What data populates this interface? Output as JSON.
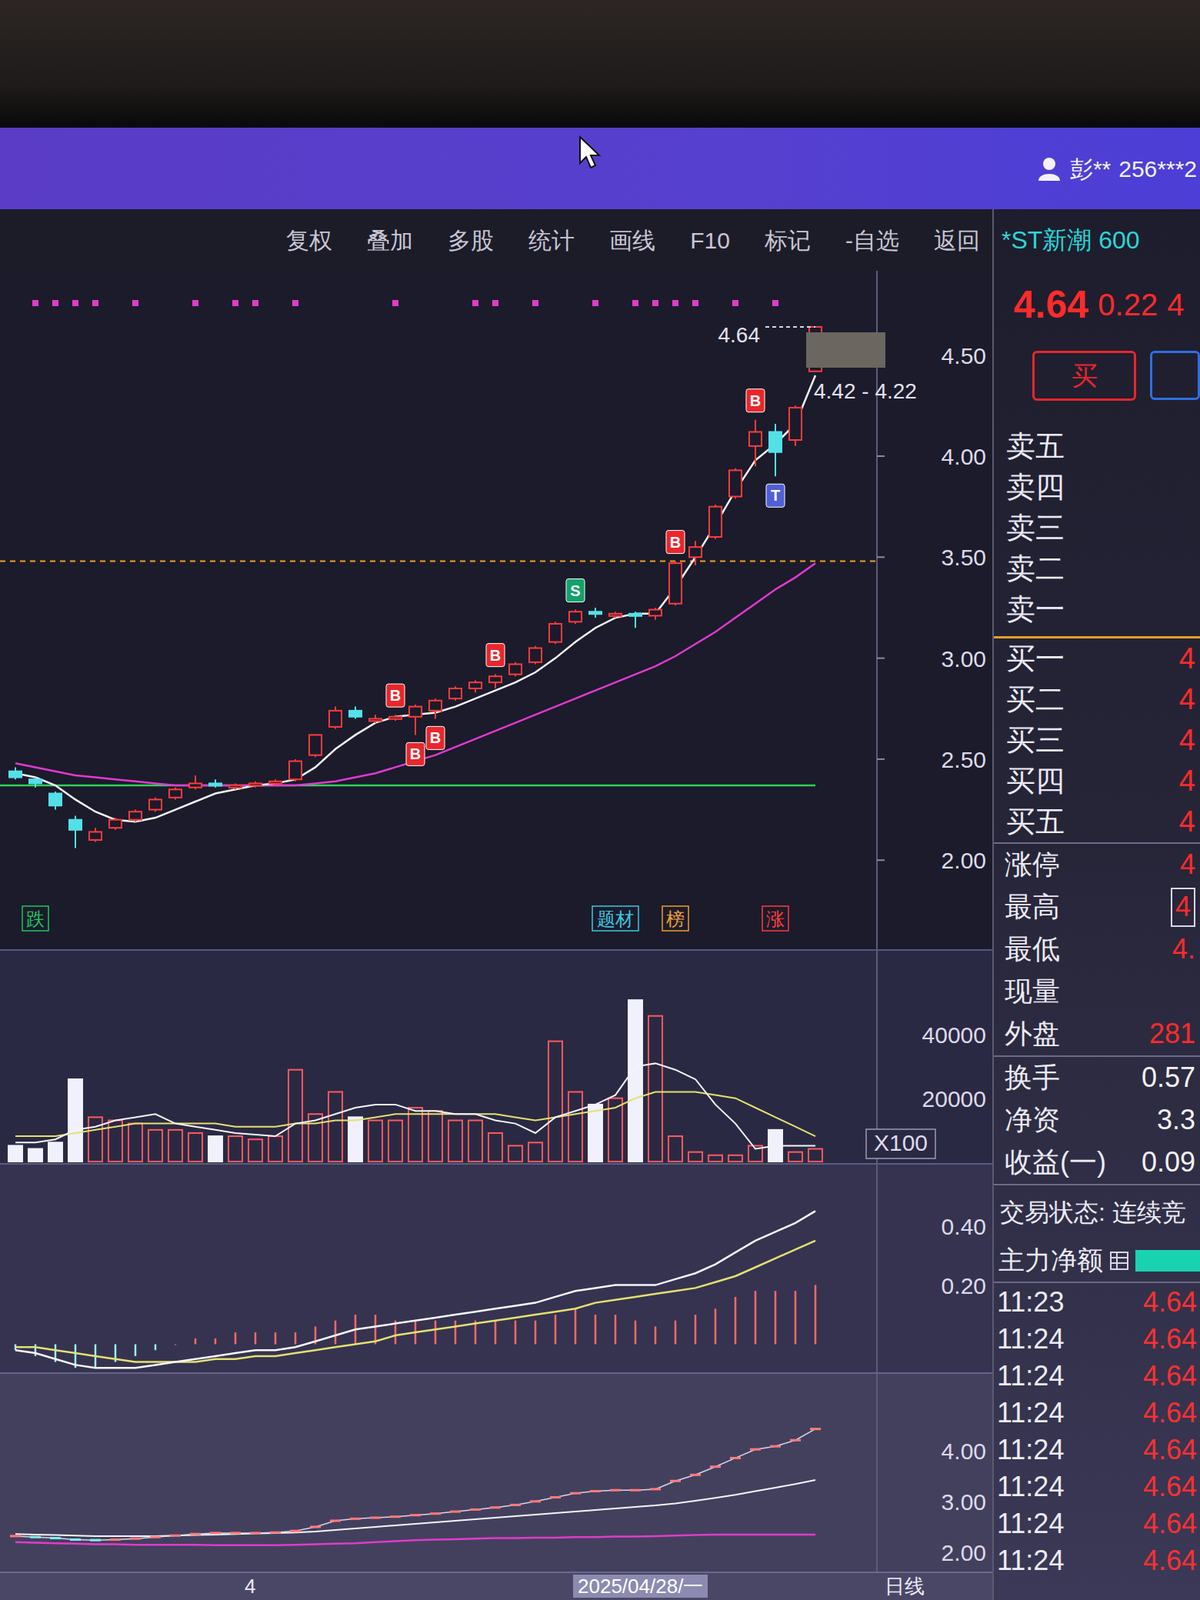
{
  "title_bar": {
    "user": "彭**",
    "account": "256***2"
  },
  "toolbar": {
    "items": [
      "复权",
      "叠加",
      "多股",
      "统计",
      "画线",
      "F10",
      "标记",
      "-自选",
      "返回"
    ]
  },
  "stock": {
    "name": "*ST新潮 600",
    "price": "4.64",
    "change": "0.22",
    "pct": "4"
  },
  "buttons": [
    {
      "label": "买",
      "color": "#e8262b"
    },
    {
      "label": "",
      "color": "#2f6fe0"
    }
  ],
  "order_book": {
    "asks": [
      {
        "label": "卖五",
        "value": ""
      },
      {
        "label": "卖四",
        "value": ""
      },
      {
        "label": "卖三",
        "value": ""
      },
      {
        "label": "卖二",
        "value": ""
      },
      {
        "label": "卖一",
        "value": ""
      }
    ],
    "bids": [
      {
        "label": "买一",
        "value": "4"
      },
      {
        "label": "买二",
        "value": "4"
      },
      {
        "label": "买三",
        "value": "4"
      },
      {
        "label": "买四",
        "value": "4"
      },
      {
        "label": "买五",
        "value": "4"
      }
    ]
  },
  "stats": [
    {
      "label": "涨停",
      "value": "4",
      "boxed": false,
      "color": "#ff2b2b"
    },
    {
      "label": "最高",
      "value": "4",
      "boxed": true,
      "color": "#ff2b2b"
    },
    {
      "label": "最低",
      "value": "4.",
      "boxed": false,
      "color": "#ff2b2b"
    },
    {
      "label": "现量",
      "value": "",
      "boxed": false,
      "color": "#ff2b2b"
    },
    {
      "label": "外盘",
      "value": "281",
      "boxed": false,
      "color": "#ff2b2b"
    }
  ],
  "stats2": [
    {
      "label": "换手",
      "value": "0.57",
      "color": "#f2f2f2"
    },
    {
      "label": "净资",
      "value": "3.3",
      "color": "#f2f2f2"
    },
    {
      "label": "收益(一)",
      "value": "0.09",
      "color": "#f2f2f2"
    }
  ],
  "trade_state": "交易状态: 连续竞",
  "main_net": {
    "label": "主力净额",
    "bar_color": "#19d3b0"
  },
  "ticks": [
    {
      "time": "11:23",
      "price": "4.64"
    },
    {
      "time": "11:24",
      "price": "4.64"
    },
    {
      "time": "11:24",
      "price": "4.64"
    },
    {
      "time": "11:24",
      "price": "4.64"
    },
    {
      "time": "11:24",
      "price": "4.64"
    },
    {
      "time": "11:24",
      "price": "4.64"
    },
    {
      "time": "11:24",
      "price": "4.64"
    },
    {
      "time": "11:24",
      "price": "4.64"
    }
  ],
  "price_chart": {
    "axis": [
      "4.50",
      "4.00",
      "3.50",
      "3.00",
      "2.50",
      "2.00"
    ],
    "candles": [
      [
        2.44,
        2.46,
        2.4,
        2.41
      ],
      [
        2.4,
        2.41,
        2.36,
        2.38
      ],
      [
        2.33,
        2.34,
        2.25,
        2.27
      ],
      [
        2.2,
        2.22,
        2.06,
        2.15
      ],
      [
        2.1,
        2.16,
        2.09,
        2.14
      ],
      [
        2.16,
        2.21,
        2.15,
        2.2
      ],
      [
        2.2,
        2.25,
        2.19,
        2.24
      ],
      [
        2.25,
        2.31,
        2.24,
        2.3
      ],
      [
        2.31,
        2.36,
        2.3,
        2.35
      ],
      [
        2.36,
        2.42,
        2.35,
        2.38
      ],
      [
        2.38,
        2.4,
        2.36,
        2.37
      ],
      [
        2.37,
        2.38,
        2.35,
        2.37
      ],
      [
        2.37,
        2.39,
        2.36,
        2.38
      ],
      [
        2.38,
        2.4,
        2.37,
        2.39
      ],
      [
        2.4,
        2.5,
        2.39,
        2.49
      ],
      [
        2.52,
        2.62,
        2.51,
        2.62
      ],
      [
        2.66,
        2.76,
        2.65,
        2.74
      ],
      [
        2.74,
        2.76,
        2.7,
        2.71
      ],
      [
        2.7,
        2.72,
        2.68,
        2.7
      ],
      [
        2.7,
        2.72,
        2.69,
        2.71
      ],
      [
        2.71,
        2.77,
        2.62,
        2.76
      ],
      [
        2.74,
        2.8,
        2.7,
        2.79
      ],
      [
        2.8,
        2.86,
        2.79,
        2.85
      ],
      [
        2.85,
        2.89,
        2.83,
        2.88
      ],
      [
        2.88,
        2.92,
        2.85,
        2.91
      ],
      [
        2.92,
        2.98,
        2.91,
        2.97
      ],
      [
        2.98,
        3.06,
        2.97,
        3.05
      ],
      [
        3.08,
        3.18,
        3.07,
        3.17
      ],
      [
        3.18,
        3.24,
        3.17,
        3.23
      ],
      [
        3.23,
        3.25,
        3.2,
        3.22
      ],
      [
        3.22,
        3.23,
        3.2,
        3.22
      ],
      [
        3.22,
        3.23,
        3.15,
        3.21
      ],
      [
        3.21,
        3.25,
        3.19,
        3.24
      ],
      [
        3.27,
        3.48,
        3.26,
        3.47
      ],
      [
        3.5,
        3.58,
        3.46,
        3.55
      ],
      [
        3.6,
        3.76,
        3.59,
        3.75
      ],
      [
        3.8,
        3.94,
        3.79,
        3.93
      ],
      [
        4.05,
        4.18,
        3.95,
        4.12
      ],
      [
        4.12,
        4.16,
        3.9,
        4.02
      ],
      [
        4.08,
        4.25,
        4.05,
        4.24
      ],
      [
        4.42,
        4.64,
        4.42,
        4.64
      ]
    ],
    "ma_white": [
      2.43,
      2.41,
      2.37,
      2.3,
      2.24,
      2.2,
      2.19,
      2.21,
      2.25,
      2.29,
      2.33,
      2.35,
      2.37,
      2.38,
      2.4,
      2.46,
      2.55,
      2.62,
      2.68,
      2.71,
      2.72,
      2.73,
      2.76,
      2.8,
      2.84,
      2.88,
      2.93,
      3.0,
      3.08,
      3.15,
      3.2,
      3.22,
      3.22,
      3.35,
      3.5,
      3.66,
      3.83,
      3.98,
      4.06,
      4.16,
      4.4
    ],
    "ma_magenta": [
      2.48,
      2.46,
      2.44,
      2.42,
      2.41,
      2.4,
      2.39,
      2.38,
      2.37,
      2.37,
      2.37,
      2.37,
      2.37,
      2.37,
      2.37,
      2.38,
      2.39,
      2.41,
      2.43,
      2.46,
      2.49,
      2.52,
      2.56,
      2.6,
      2.64,
      2.68,
      2.72,
      2.76,
      2.8,
      2.84,
      2.88,
      2.92,
      2.96,
      3.01,
      3.07,
      3.13,
      3.2,
      3.27,
      3.34,
      3.4,
      3.47
    ],
    "support_line": 2.37,
    "resistance_line": 3.48,
    "dot_row": [
      1,
      2,
      3,
      4,
      6,
      9,
      11,
      12,
      14,
      19,
      23,
      24,
      26,
      29,
      31,
      32,
      33,
      34,
      36,
      38
    ],
    "signals": [
      {
        "index": 19,
        "label": "B",
        "color": "#e8262b",
        "below": false
      },
      {
        "index": 20,
        "label": "B",
        "color": "#e8262b",
        "below": true
      },
      {
        "index": 21,
        "label": "B",
        "color": "#e8262b",
        "below": true
      },
      {
        "index": 24,
        "label": "B",
        "color": "#e8262b",
        "below": false
      },
      {
        "index": 28,
        "label": "S",
        "color": "#12a26a",
        "below": false
      },
      {
        "index": 33,
        "label": "B",
        "color": "#e8262b",
        "below": false
      },
      {
        "index": 37,
        "label": "B",
        "color": "#e8262b",
        "below": false
      },
      {
        "index": 38,
        "label": "T",
        "color": "#4f5fd6",
        "below": true
      }
    ],
    "last_label": "4.64",
    "range_label": "4.42 - 4.22",
    "tags": [
      {
        "label": "跌",
        "color": "#22c55e",
        "index": 1
      },
      {
        "label": "题材",
        "color": "#3cc9e0",
        "index": 30
      },
      {
        "label": "榜",
        "color": "#f0a030",
        "index": 33
      },
      {
        "label": "涨",
        "color": "#ff3b3b",
        "index": 38
      }
    ]
  },
  "volume_chart": {
    "axis": [
      "40000",
      "20000"
    ],
    "unit": "X100",
    "values": [
      5000,
      4000,
      6000,
      26000,
      14000,
      13000,
      12000,
      10000,
      10000,
      9000,
      8000,
      8000,
      7000,
      8000,
      29000,
      15000,
      22000,
      14000,
      13000,
      13000,
      17000,
      16000,
      13000,
      13000,
      9000,
      5000,
      6000,
      38000,
      22000,
      18000,
      20000,
      51000,
      46000,
      8000,
      3000,
      2000,
      2000,
      5000,
      10000,
      3000,
      4000
    ],
    "ma_white": [
      6000,
      6000,
      7000,
      10000,
      11000,
      13000,
      14000,
      15000,
      12000,
      11000,
      10000,
      9000,
      8500,
      8000,
      12000,
      13000,
      15000,
      17000,
      18000,
      18000,
      16000,
      16000,
      15000,
      15000,
      13000,
      12000,
      9000,
      14000,
      16000,
      18000,
      21000,
      30000,
      31000,
      29000,
      26000,
      18000,
      12000,
      4000,
      5000,
      5000,
      5000
    ],
    "ma_yellow": [
      8000,
      8000,
      8000,
      9000,
      10000,
      11000,
      12000,
      12000,
      12000,
      12000,
      12000,
      11000,
      11000,
      11000,
      12000,
      12000,
      13000,
      13000,
      14000,
      15000,
      15000,
      15000,
      15000,
      15000,
      15000,
      14000,
      13000,
      14000,
      15000,
      16000,
      17000,
      20000,
      22000,
      22000,
      22000,
      21000,
      20000,
      17000,
      14000,
      11000,
      8000
    ]
  },
  "macd_chart": {
    "axis": [
      "0.40",
      "0.20"
    ],
    "dif": [
      -0.02,
      -0.03,
      -0.05,
      -0.07,
      -0.08,
      -0.08,
      -0.08,
      -0.07,
      -0.06,
      -0.05,
      -0.04,
      -0.03,
      -0.02,
      -0.02,
      -0.01,
      0.01,
      0.03,
      0.05,
      0.06,
      0.07,
      0.08,
      0.09,
      0.1,
      0.11,
      0.12,
      0.13,
      0.14,
      0.16,
      0.18,
      0.19,
      0.2,
      0.2,
      0.2,
      0.22,
      0.24,
      0.27,
      0.31,
      0.35,
      0.38,
      0.41,
      0.45
    ],
    "dea": [
      -0.01,
      -0.01,
      -0.02,
      -0.03,
      -0.04,
      -0.05,
      -0.06,
      -0.06,
      -0.06,
      -0.06,
      -0.05,
      -0.05,
      -0.04,
      -0.04,
      -0.03,
      -0.02,
      -0.01,
      0.0,
      0.01,
      0.03,
      0.04,
      0.05,
      0.06,
      0.07,
      0.08,
      0.09,
      0.1,
      0.11,
      0.12,
      0.14,
      0.15,
      0.16,
      0.17,
      0.18,
      0.19,
      0.21,
      0.23,
      0.26,
      0.29,
      0.32,
      0.35
    ],
    "hist": [
      -0.02,
      -0.04,
      -0.06,
      -0.08,
      -0.08,
      -0.06,
      -0.04,
      -0.02,
      0.0,
      0.02,
      0.02,
      0.04,
      0.04,
      0.04,
      0.04,
      0.06,
      0.08,
      0.1,
      0.1,
      0.08,
      0.08,
      0.08,
      0.08,
      0.08,
      0.08,
      0.08,
      0.08,
      0.1,
      0.12,
      0.1,
      0.1,
      0.08,
      0.06,
      0.08,
      0.1,
      0.12,
      0.16,
      0.18,
      0.18,
      0.18,
      0.2
    ]
  },
  "band_chart": {
    "axis": [
      "4.00",
      "3.00",
      "2.00"
    ],
    "upper": [
      2.32,
      2.3,
      2.28,
      2.25,
      2.24,
      2.25,
      2.27,
      2.3,
      2.33,
      2.36,
      2.38,
      2.38,
      2.38,
      2.39,
      2.42,
      2.5,
      2.62,
      2.66,
      2.68,
      2.7,
      2.73,
      2.76,
      2.8,
      2.84,
      2.88,
      2.93,
      3.0,
      3.08,
      3.16,
      3.2,
      3.22,
      3.22,
      3.24,
      3.4,
      3.52,
      3.68,
      3.85,
      4.02,
      4.08,
      4.2,
      4.42
    ],
    "mid": [
      2.36,
      2.35,
      2.34,
      2.33,
      2.32,
      2.32,
      2.32,
      2.32,
      2.33,
      2.34,
      2.35,
      2.36,
      2.37,
      2.38,
      2.39,
      2.41,
      2.44,
      2.47,
      2.5,
      2.53,
      2.56,
      2.59,
      2.62,
      2.65,
      2.68,
      2.71,
      2.74,
      2.77,
      2.8,
      2.83,
      2.86,
      2.89,
      2.92,
      2.96,
      3.01,
      3.07,
      3.13,
      3.2,
      3.27,
      3.34,
      3.42
    ],
    "lower": [
      2.2,
      2.19,
      2.18,
      2.17,
      2.16,
      2.16,
      2.15,
      2.15,
      2.15,
      2.15,
      2.14,
      2.14,
      2.14,
      2.14,
      2.15,
      2.16,
      2.17,
      2.18,
      2.2,
      2.22,
      2.24,
      2.25,
      2.26,
      2.27,
      2.28,
      2.28,
      2.29,
      2.29,
      2.3,
      2.3,
      2.31,
      2.31,
      2.32,
      2.33,
      2.34,
      2.35,
      2.35,
      2.35,
      2.35,
      2.35,
      2.35
    ]
  },
  "time_axis": [
    {
      "label": "4",
      "selected": false
    },
    {
      "label": "2025/04/28/一",
      "selected": true
    },
    {
      "label": "日线",
      "selected": false
    }
  ]
}
